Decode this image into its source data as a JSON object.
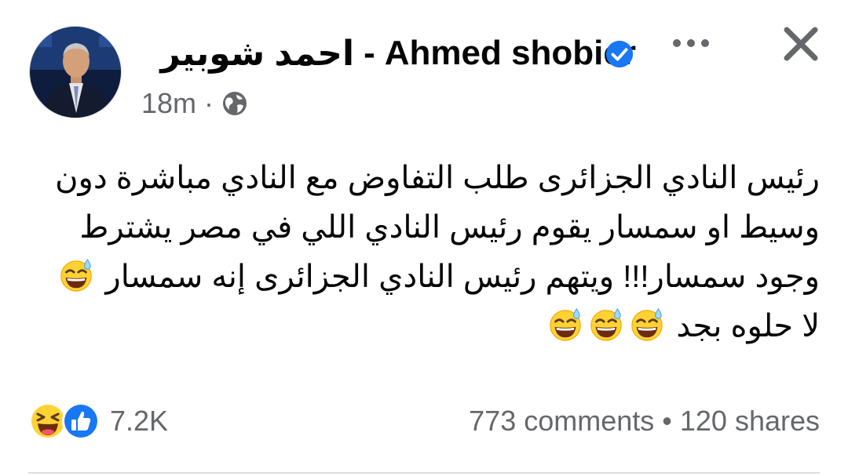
{
  "post": {
    "author": {
      "name_ar": "احمد شوبير",
      "separator": "-",
      "name_en": "Ahmed shobier",
      "verified": true
    },
    "meta": {
      "time": "18m",
      "dot": "·",
      "audience_icon": "globe-icon"
    },
    "text_lines": [
      "رئيس النادي الجزائرى طلب التفاوض مع النادي مباشرة دون",
      "وسيط او سمسار يقوم رئيس النادي اللي في مصر يشترط",
      "وجود سمسار!!! ويتهم رئيس النادي الجزائرى إنه سمسار",
      "لا حلوه بجد"
    ],
    "text_emoji": [
      "grinning-sweat-emoji",
      "grinning-sweat-emoji",
      "grinning-sweat-emoji",
      "grinning-sweat-emoji"
    ],
    "reactions": {
      "icons": [
        "haha-reaction-icon",
        "like-reaction-icon"
      ],
      "count": "7.2K"
    },
    "stats": {
      "comments": "773 comments",
      "separator": "•",
      "shares": "120 shares"
    }
  },
  "actions": {
    "more_icon": "more-options-icon",
    "close_icon": "close-icon"
  },
  "colors": {
    "text": "#050505",
    "secondary_text": "#65676b",
    "verified_blue": "#1877f2",
    "divider": "#dadde1"
  }
}
